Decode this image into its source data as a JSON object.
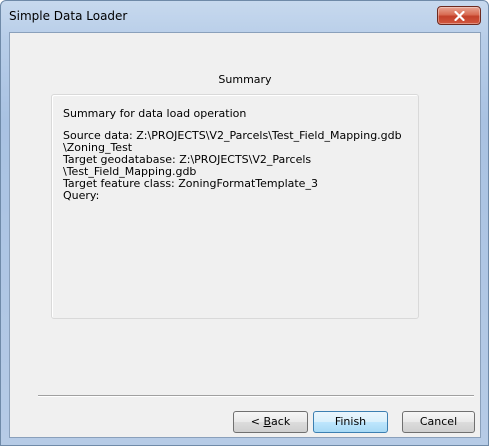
{
  "window": {
    "title": "Simple Data Loader"
  },
  "page": {
    "heading": "Summary"
  },
  "summary": {
    "header": "Summary for data load operation",
    "lines": [
      "Source data: Z:\\PROJECTS\\V2_Parcels\\Test_Field_Mapping.gdb",
      "\\Zoning_Test",
      "Target geodatabase: Z:\\PROJECTS\\V2_Parcels",
      "\\Test_Field_Mapping.gdb",
      "Target feature class: ZoningFormatTemplate_3",
      "Query:"
    ]
  },
  "buttons": {
    "back_prefix": "< ",
    "back_mnemonic": "B",
    "back_rest": "ack",
    "finish": "Finish",
    "cancel": "Cancel"
  },
  "colors": {
    "close_button": "#c3412a",
    "default_button_border": "#3c7fb1"
  }
}
